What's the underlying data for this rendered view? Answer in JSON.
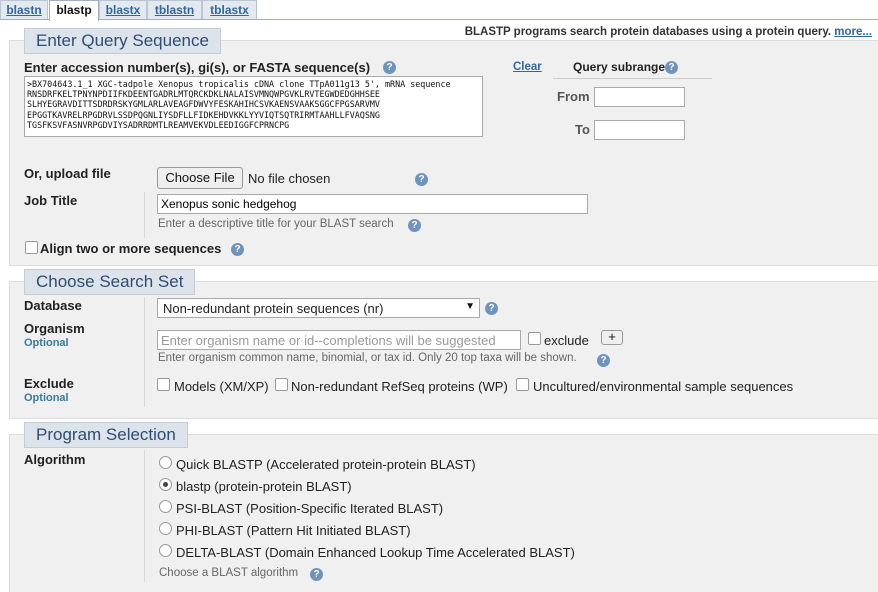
{
  "tabs": [
    {
      "label": "blastn",
      "active": false
    },
    {
      "label": "blastp",
      "active": true
    },
    {
      "label": "blastx",
      "active": false
    },
    {
      "label": "tblastn",
      "active": false
    },
    {
      "label": "tblastx",
      "active": false
    }
  ],
  "tagline": {
    "text": "BLASTP programs search protein databases using a protein query.",
    "more_link": "more..."
  },
  "query": {
    "legend": "Enter Query Sequence",
    "label": "Enter accession number(s), gi(s), or FASTA sequence(s)",
    "clear_link": "Clear",
    "sequence": ">BX704643.1_1 XGC-tadpole Xenopus tropicalis cDNA clone TTpA011g13 5', mRNA sequence\nRNSDRFKELTPNYNPDIIFKDEENTGADRLMTQRCKDKLNALAISVMNQWPGVKLRVTEGWDEDGHHSEE\nSLHYEGRAVDITTSDRDRSKYGMLARLAVEAGFDWVYFESKAHIHCSVKAENSVAAKSGGCFPGSARVMV\nEPGGTKAVRELRPGDRVLSSDPQGNLIYSDFLLFIDKEHDVKKLYYVIQTSQTRIRMTAAHLLFVAQSNG\nTGSFKSVFASNVRPGDVIYSADRRDMTLREAMVEKVDLEEDIGGFCPRNCPG",
    "subrange": {
      "title": "Query subrange",
      "from_label": "From",
      "to_label": "To",
      "from_value": "",
      "to_value": ""
    },
    "upload_label": "Or, upload file",
    "choose_file_button": "Choose File",
    "no_file_text": "No file chosen",
    "job_title_label": "Job Title",
    "job_title_value": "Xenopus sonic hedgehog",
    "job_title_hint": "Enter a descriptive title for your BLAST search",
    "align_two_label": "Align two or more sequences",
    "align_two_checked": false
  },
  "search_set": {
    "legend": "Choose Search Set",
    "database_label": "Database",
    "database_value": "Non-redundant protein sequences (nr)",
    "organism_label": "Organism",
    "optional_label": "Optional",
    "organism_placeholder": "Enter organism name or id--completions will be suggested",
    "exclude_checkbox_label": "exclude",
    "add_button": "+",
    "organism_hint": "Enter organism common name, binomial, or tax id. Only 20 top taxa will be shown.",
    "exclude_label": "Exclude",
    "exclude_optional_label": "Optional",
    "exclude_options": [
      {
        "label": "Models (XM/XP)",
        "checked": false
      },
      {
        "label": "Non-redundant RefSeq proteins (WP)",
        "checked": false
      },
      {
        "label": "Uncultured/environmental sample sequences",
        "checked": false
      }
    ]
  },
  "program": {
    "legend": "Program Selection",
    "algorithm_label": "Algorithm",
    "options": [
      {
        "label": "Quick BLASTP (Accelerated protein-protein BLAST)",
        "selected": false
      },
      {
        "label": "blastp (protein-protein BLAST)",
        "selected": true
      },
      {
        "label": "PSI-BLAST (Position-Specific Iterated BLAST)",
        "selected": false
      },
      {
        "label": "PHI-BLAST (Pattern Hit Initiated BLAST)",
        "selected": false
      },
      {
        "label": "DELTA-BLAST (Domain Enhanced Lookup Time Accelerated BLAST)",
        "selected": false
      }
    ],
    "hint": "Choose a BLAST algorithm"
  },
  "icons": {
    "help": "question-circle-icon",
    "dropdown": "caret-down-icon"
  },
  "colors": {
    "link": "#336699",
    "legend_text": "#2e4d73",
    "section_bg": "#f0f0f0",
    "help_icon": "#6f93bd"
  }
}
